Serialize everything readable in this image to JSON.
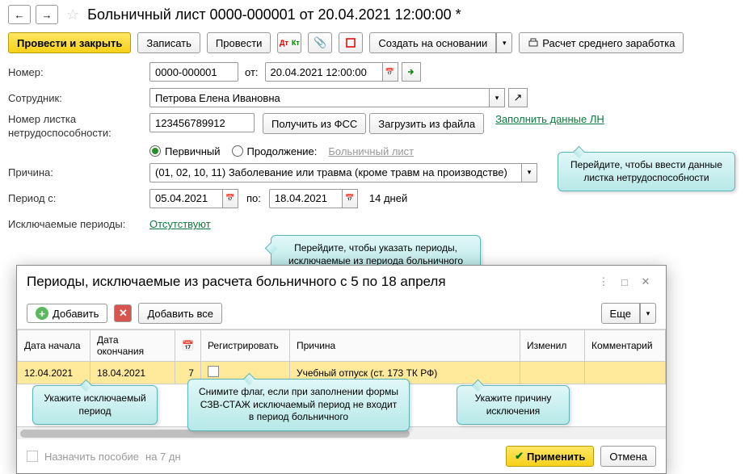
{
  "header": {
    "title": "Больничный лист 0000-000001 от 20.04.2021 12:00:00 *"
  },
  "toolbar": {
    "post_close": "Провести и закрыть",
    "write": "Записать",
    "post": "Провести",
    "create_based": "Создать на основании",
    "calc_avg": "Расчет среднего заработка"
  },
  "form": {
    "number_lbl": "Номер:",
    "number": "0000-000001",
    "date_lbl": "от:",
    "date": "20.04.2021 12:00:00",
    "employee_lbl": "Сотрудник:",
    "employee": "Петрова Елена Ивановна",
    "sheet_no_lbl": "Номер листка нетрудоспособности:",
    "sheet_no": "123456789912",
    "get_fss": "Получить из ФСС",
    "load_file": "Загрузить из файла",
    "fill_ln": "Заполнить данные ЛН",
    "primary": "Первичный",
    "continuation": "Продолжение:",
    "cont_link": "Больничный лист",
    "reason_lbl": "Причина:",
    "reason": "(01, 02, 10, 11) Заболевание или травма (кроме травм на производстве)",
    "period_from_lbl": "Период с:",
    "period_from": "05.04.2021",
    "period_to_lbl": "по:",
    "period_to": "18.04.2021",
    "days": "14 дней",
    "excluded_lbl": "Исключаемые периоды:",
    "excluded": "Отсутствуют"
  },
  "callouts": {
    "c1": "Перейдите, чтобы ввести данные листка нетрудоспособности",
    "c2": "Перейдите, чтобы указать периоды, исключаемые из периода больничного",
    "c3": "Укажите исключаемый период",
    "c4": "Снимите флаг, если при заполнении формы СЗВ-СТАЖ исключаемый период не входит в период больничного",
    "c5": "Укажите причину исключения"
  },
  "dialog": {
    "title": "Периоды, исключаемые из расчета больничного с 5 по 18 апреля",
    "add": "Добавить",
    "add_all": "Добавить все",
    "more": "Еще",
    "cols": {
      "start": "Дата начала",
      "end": "Дата окончания",
      "days": "",
      "register": "Регистрировать",
      "reason": "Причина",
      "changed": "Изменил",
      "comment": "Комментарий"
    },
    "row": {
      "start": "12.04.2021",
      "end": "18.04.2021",
      "days": "7",
      "reason": "Учебный отпуск (ст. 173 ТК РФ)"
    },
    "assign": "Назначить пособие",
    "assign_days": "на 7 дн",
    "apply": "Применить",
    "cancel": "Отмена"
  }
}
